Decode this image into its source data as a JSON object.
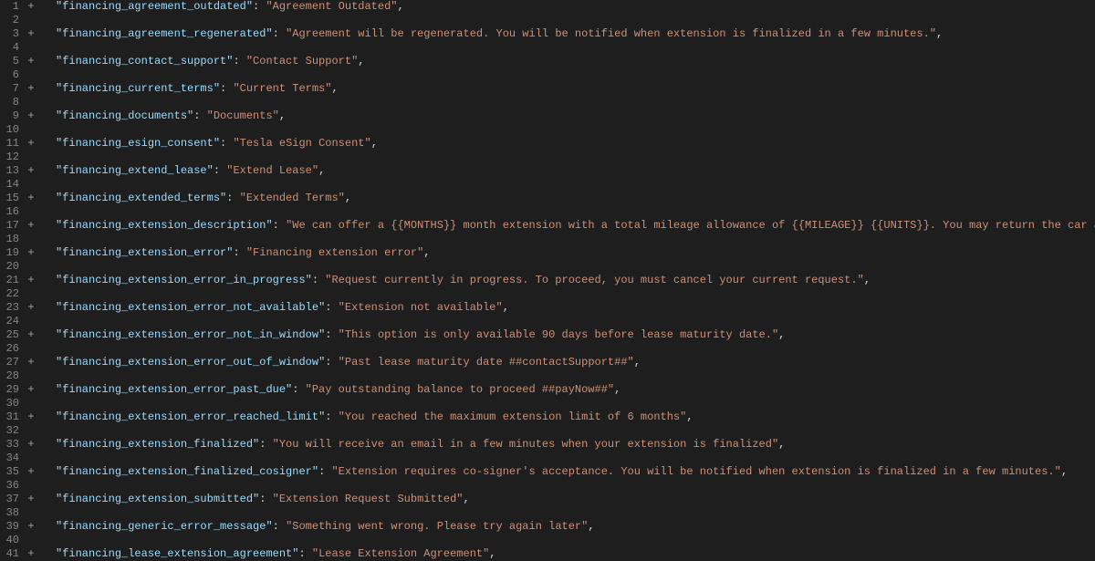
{
  "lines": [
    {
      "n": 1,
      "marker": "+",
      "key": "financing_agreement_outdated",
      "value": "Agreement Outdated"
    },
    {
      "n": 2,
      "marker": "",
      "key": null,
      "value": null
    },
    {
      "n": 3,
      "marker": "+",
      "key": "financing_agreement_regenerated",
      "value": "Agreement will be regenerated. You will be notified when extension is finalized in a few minutes."
    },
    {
      "n": 4,
      "marker": "",
      "key": null,
      "value": null
    },
    {
      "n": 5,
      "marker": "+",
      "key": "financing_contact_support",
      "value": "Contact Support"
    },
    {
      "n": 6,
      "marker": "",
      "key": null,
      "value": null
    },
    {
      "n": 7,
      "marker": "+",
      "key": "financing_current_terms",
      "value": "Current Terms"
    },
    {
      "n": 8,
      "marker": "",
      "key": null,
      "value": null
    },
    {
      "n": 9,
      "marker": "+",
      "key": "financing_documents",
      "value": "Documents"
    },
    {
      "n": 10,
      "marker": "",
      "key": null,
      "value": null
    },
    {
      "n": 11,
      "marker": "+",
      "key": "financing_esign_consent",
      "value": "Tesla eSign Consent"
    },
    {
      "n": 12,
      "marker": "",
      "key": null,
      "value": null
    },
    {
      "n": 13,
      "marker": "+",
      "key": "financing_extend_lease",
      "value": "Extend Lease"
    },
    {
      "n": 14,
      "marker": "",
      "key": null,
      "value": null
    },
    {
      "n": 15,
      "marker": "+",
      "key": "financing_extended_terms",
      "value": "Extended Terms"
    },
    {
      "n": 16,
      "marker": "",
      "key": null,
      "value": null
    },
    {
      "n": 17,
      "marker": "+",
      "key": "financing_extension_description",
      "value": "We can offer a {{MONTHS}} month extension with a total mileage allowance of {{MILEAGE}} {{UNITS}}. You may return the car at any time without penalties."
    },
    {
      "n": 18,
      "marker": "",
      "key": null,
      "value": null
    },
    {
      "n": 19,
      "marker": "+",
      "key": "financing_extension_error",
      "value": "Financing extension error"
    },
    {
      "n": 20,
      "marker": "",
      "key": null,
      "value": null
    },
    {
      "n": 21,
      "marker": "+",
      "key": "financing_extension_error_in_progress",
      "value": "Request currently in progress. To proceed, you must cancel your current request."
    },
    {
      "n": 22,
      "marker": "",
      "key": null,
      "value": null
    },
    {
      "n": 23,
      "marker": "+",
      "key": "financing_extension_error_not_available",
      "value": "Extension not available"
    },
    {
      "n": 24,
      "marker": "",
      "key": null,
      "value": null
    },
    {
      "n": 25,
      "marker": "+",
      "key": "financing_extension_error_not_in_window",
      "value": "This option is only available 90 days before lease maturity date."
    },
    {
      "n": 26,
      "marker": "",
      "key": null,
      "value": null
    },
    {
      "n": 27,
      "marker": "+",
      "key": "financing_extension_error_out_of_window",
      "value": "Past lease maturity date ##contactSupport##"
    },
    {
      "n": 28,
      "marker": "",
      "key": null,
      "value": null
    },
    {
      "n": 29,
      "marker": "+",
      "key": "financing_extension_error_past_due",
      "value": "Pay outstanding balance to proceed ##payNow##"
    },
    {
      "n": 30,
      "marker": "",
      "key": null,
      "value": null
    },
    {
      "n": 31,
      "marker": "+",
      "key": "financing_extension_error_reached_limit",
      "value": "You reached the maximum extension limit of 6 months"
    },
    {
      "n": 32,
      "marker": "",
      "key": null,
      "value": null
    },
    {
      "n": 33,
      "marker": "+",
      "key": "financing_extension_finalized",
      "value": "You will receive an email in a few minutes when your extension is finalized"
    },
    {
      "n": 34,
      "marker": "",
      "key": null,
      "value": null
    },
    {
      "n": 35,
      "marker": "+",
      "key": "financing_extension_finalized_cosigner",
      "value": "Extension requires co-signer's acceptance. You will be notified when extension is finalized in a few minutes."
    },
    {
      "n": 36,
      "marker": "",
      "key": null,
      "value": null
    },
    {
      "n": 37,
      "marker": "+",
      "key": "financing_extension_submitted",
      "value": "Extension Request Submitted"
    },
    {
      "n": 38,
      "marker": "",
      "key": null,
      "value": null
    },
    {
      "n": 39,
      "marker": "+",
      "key": "financing_generic_error_message",
      "value": "Something went wrong. Please try again later"
    },
    {
      "n": 40,
      "marker": "",
      "key": null,
      "value": null
    },
    {
      "n": 41,
      "marker": "+",
      "key": "financing_lease_extension_agreement",
      "value": "Lease Extension Agreement"
    }
  ]
}
